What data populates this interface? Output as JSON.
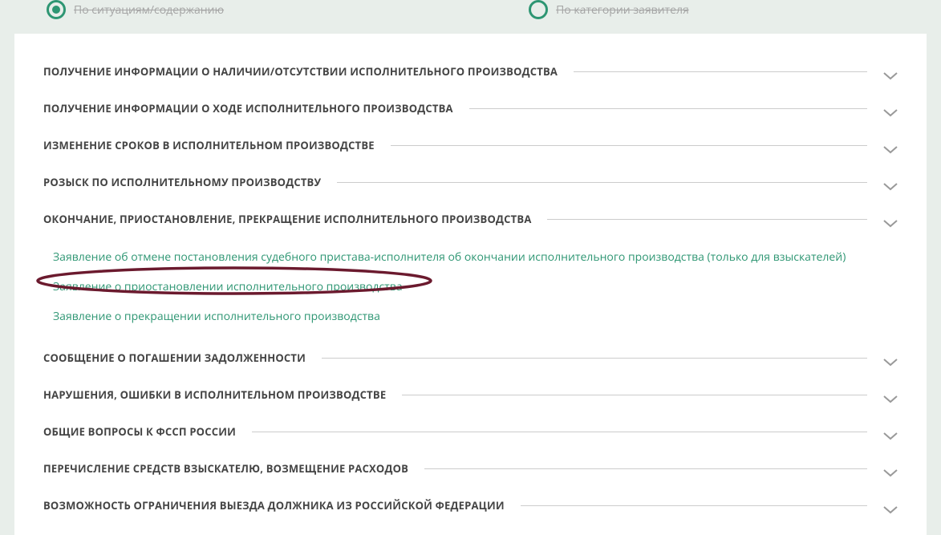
{
  "radios": {
    "situations": "По ситуациям/содержанию",
    "category": "По категории заявителя"
  },
  "sections": [
    {
      "title": "ПОЛУЧЕНИЕ ИНФОРМАЦИИ О НАЛИЧИИ/ОТСУТСТВИИ ИСПОЛНИТЕЛЬНОГО ПРОИЗВОДСТВА"
    },
    {
      "title": "ПОЛУЧЕНИЕ ИНФОРМАЦИИ О ХОДЕ ИСПОЛНИТЕЛЬНОГО ПРОИЗВОДСТВА"
    },
    {
      "title": "ИЗМЕНЕНИЕ СРОКОВ В ИСПОЛНИТЕЛЬНОМ ПРОИЗВОДСТВЕ"
    },
    {
      "title": "РОЗЫСК ПО ИСПОЛНИТЕЛЬНОМУ ПРОИЗВОДСТВУ"
    },
    {
      "title": "ОКОНЧАНИЕ, ПРИОСТАНОВЛЕНИЕ, ПРЕКРАЩЕНИЕ ИСПОЛНИТЕЛЬНОГО ПРОИЗВОДСТВА",
      "links": [
        "Заявление об отмене постановления судебного пристава-исполнителя об окончании исполнительного производства (только для взыскателей)",
        "Заявление о приостановлении исполнительного производства",
        "Заявление о прекращении исполнительного производства"
      ]
    },
    {
      "title": "СООБЩЕНИЕ О ПОГАШЕНИИ ЗАДОЛЖЕННОСТИ"
    },
    {
      "title": "НАРУШЕНИЯ, ОШИБКИ В ИСПОЛНИТЕЛЬНОМ ПРОИЗВОДСТВЕ"
    },
    {
      "title": "ОБЩИЕ ВОПРОСЫ К ФССП РОССИИ"
    },
    {
      "title": "ПЕРЕЧИСЛЕНИЕ СРЕДСТВ ВЗЫСКАТЕЛЮ, ВОЗМЕЩЕНИЕ РАСХОДОВ"
    },
    {
      "title": "ВОЗМОЖНОСТЬ ОГРАНИЧЕНИЯ ВЫЕЗДА ДОЛЖНИКА ИЗ РОССИЙСКОЙ ФЕДЕРАЦИИ"
    }
  ]
}
